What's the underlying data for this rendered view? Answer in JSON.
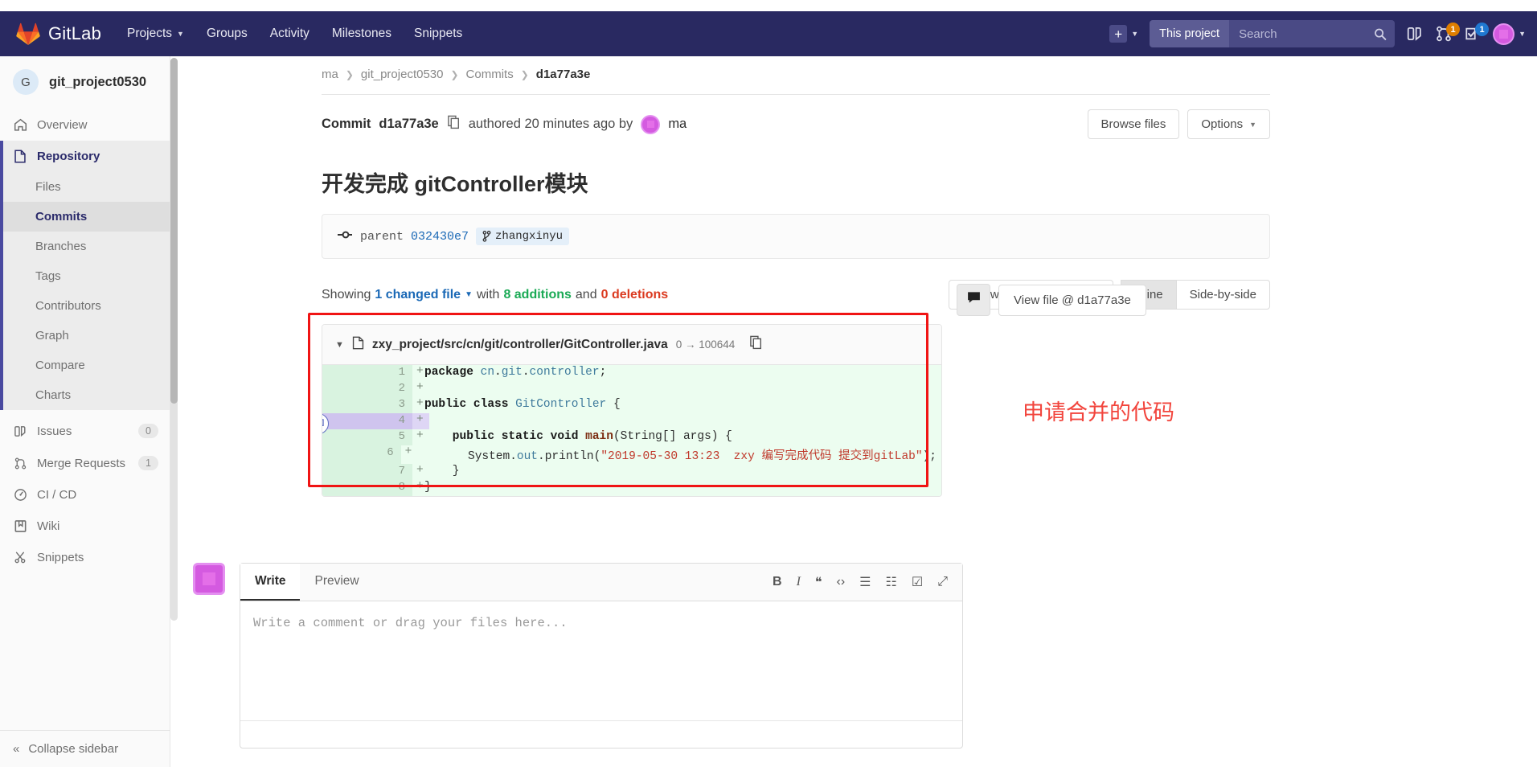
{
  "navbar": {
    "brand": "GitLab",
    "links": [
      {
        "label": "Projects",
        "caret": true
      },
      {
        "label": "Groups",
        "caret": false
      },
      {
        "label": "Activity",
        "caret": false
      },
      {
        "label": "Milestones",
        "caret": false
      },
      {
        "label": "Snippets",
        "caret": false
      }
    ],
    "plus_icon": "plus-icon",
    "search_scope": "This project",
    "search_placeholder": "Search",
    "search_value": "",
    "search_icon": "search-icon",
    "issues_board_icon": "issues-board-icon",
    "merge_requests_icon": "merge-request-icon",
    "merge_requests_count": "1",
    "todos_icon": "todos-icon",
    "todos_count": "1",
    "avatar_icon": "user-avatar"
  },
  "sidebar": {
    "project_initial": "G",
    "project_name": "git_project0530",
    "overview": {
      "label": "Overview",
      "icon": "home-icon"
    },
    "repository": {
      "label": "Repository",
      "icon": "file-icon"
    },
    "repository_children": [
      {
        "label": "Files",
        "active": false
      },
      {
        "label": "Commits",
        "active": true
      },
      {
        "label": "Branches",
        "active": false
      },
      {
        "label": "Tags",
        "active": false
      },
      {
        "label": "Contributors",
        "active": false
      },
      {
        "label": "Graph",
        "active": false
      },
      {
        "label": "Compare",
        "active": false
      },
      {
        "label": "Charts",
        "active": false
      }
    ],
    "items": [
      {
        "label": "Issues",
        "icon": "issues-icon",
        "count": "0"
      },
      {
        "label": "Merge Requests",
        "icon": "merge-request-icon",
        "count": "1"
      },
      {
        "label": "CI / CD",
        "icon": "pipeline-icon",
        "count": ""
      },
      {
        "label": "Wiki",
        "icon": "book-icon",
        "count": ""
      },
      {
        "label": "Snippets",
        "icon": "scissors-icon",
        "count": ""
      }
    ],
    "collapse": {
      "label": "Collapse sidebar",
      "icon": "chevrons-left-icon"
    }
  },
  "breadcrumb": [
    {
      "label": "ma",
      "last": false
    },
    {
      "label": "git_project0530",
      "last": false
    },
    {
      "label": "Commits",
      "last": false
    },
    {
      "label": "d1a77a3e",
      "last": true
    }
  ],
  "commit": {
    "prefix": "Commit",
    "sha": "d1a77a3e",
    "copy_icon": "copy-icon",
    "authored_text": "authored 20 minutes ago by",
    "author": "ma",
    "message": "开发完成 gitController模块",
    "browse_files_label": "Browse files",
    "options_label": "Options",
    "parent": {
      "icon": "commit-node-icon",
      "label": "parent",
      "sha": "032430e7",
      "branch_icon": "branch-icon",
      "branch": "zhangxinyu"
    }
  },
  "diff_stats": {
    "showing": "Showing",
    "changed_file": "1 changed file",
    "caret_icon": "chevron-down-icon",
    "with": "with",
    "additions": "8 additions",
    "and": "and",
    "deletions": "0 deletions",
    "hide_whitespace_label": "Hide whitespace changes",
    "inline_label": "Inline",
    "side_by_side_label": "Side-by-side",
    "active_view": "Inline"
  },
  "diff": {
    "collapse_icon": "triangle-down-icon",
    "file_icon": "file-icon",
    "path": "zxy_project/src/cn/git/controller/GitController.java",
    "mode": "0 → 100644",
    "copy_path_icon": "copy-icon",
    "comment_icon": "comment-bubble-icon",
    "view_file_label": "View file @ d1a77a3e",
    "annotation": "申请合并的代码",
    "comment_marker_icon": "comment-bubble-icon",
    "lines": [
      {
        "n": "1",
        "sign": "+",
        "highlight": false,
        "tokens": [
          {
            "t": "package ",
            "c": "tok-kw"
          },
          {
            "t": "cn",
            "c": "tok-ns"
          },
          {
            "t": ".",
            "c": "tok-pl"
          },
          {
            "t": "git",
            "c": "tok-ns"
          },
          {
            "t": ".",
            "c": "tok-pl"
          },
          {
            "t": "controller",
            "c": "tok-ns"
          },
          {
            "t": ";",
            "c": "tok-pl"
          }
        ]
      },
      {
        "n": "2",
        "sign": "+",
        "highlight": false,
        "tokens": []
      },
      {
        "n": "3",
        "sign": "+",
        "highlight": false,
        "tokens": [
          {
            "t": "public class ",
            "c": "tok-kw"
          },
          {
            "t": "GitController",
            "c": "tok-ns"
          },
          {
            "t": " {",
            "c": "tok-pl"
          }
        ]
      },
      {
        "n": "4",
        "sign": "+",
        "highlight": true,
        "tokens": []
      },
      {
        "n": "5",
        "sign": "+",
        "highlight": false,
        "tokens": [
          {
            "t": "    public static void ",
            "c": "tok-kw"
          },
          {
            "t": "main",
            "c": "tok-fn"
          },
          {
            "t": "(String[] args) {",
            "c": "tok-pl"
          }
        ]
      },
      {
        "n": "6",
        "sign": "+",
        "highlight": false,
        "tokens": [
          {
            "t": "        System.",
            "c": "tok-pl"
          },
          {
            "t": "out",
            "c": "tok-ns"
          },
          {
            "t": ".",
            "c": "tok-pl"
          },
          {
            "t": "println",
            "c": "tok-pl"
          },
          {
            "t": "(",
            "c": "tok-pl"
          },
          {
            "t": "\"2019-05-30 13:23  zxy 编写完成代码 提交到gitLab\"",
            "c": "tok-str"
          },
          {
            "t": ");",
            "c": "tok-pl"
          }
        ]
      },
      {
        "n": "7",
        "sign": "+",
        "highlight": false,
        "tokens": [
          {
            "t": "    }",
            "c": "tok-pl"
          }
        ]
      },
      {
        "n": "8",
        "sign": "+",
        "highlight": false,
        "tokens": [
          {
            "t": "}",
            "c": "tok-pl"
          }
        ]
      }
    ]
  },
  "comment_editor": {
    "avatar_icon": "user-avatar",
    "tabs": [
      {
        "label": "Write",
        "active": true
      },
      {
        "label": "Preview",
        "active": false
      }
    ],
    "tools": [
      {
        "glyph": "B",
        "name": "bold-icon"
      },
      {
        "glyph": "I",
        "name": "italic-icon"
      },
      {
        "glyph": "❝",
        "name": "quote-icon"
      },
      {
        "glyph": "‹›",
        "name": "code-icon"
      },
      {
        "glyph": "☰",
        "name": "bullet-list-icon"
      },
      {
        "glyph": "☷",
        "name": "numbered-list-icon"
      },
      {
        "glyph": "☑",
        "name": "task-list-icon"
      },
      {
        "glyph": "⤢",
        "name": "fullscreen-icon"
      }
    ],
    "placeholder": "Write a comment or drag your files here..."
  },
  "colors": {
    "navbar": "#292961",
    "accent": "#1b69b6",
    "addition": "#1aaa55",
    "deletion": "#db3b21",
    "annotation": "#f2453d",
    "highlight_box": "#f01414"
  }
}
